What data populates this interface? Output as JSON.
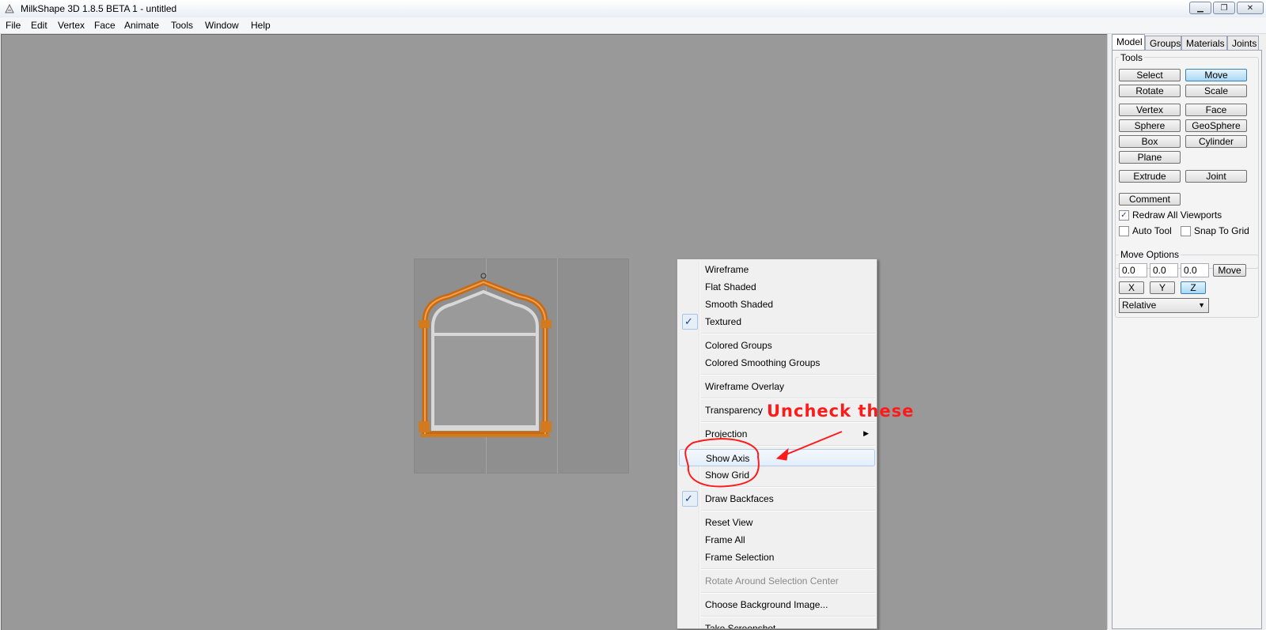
{
  "window": {
    "title": "MilkShape 3D 1.8.5 BETA 1 - untitled",
    "minimize": "▁",
    "maximize": "❐",
    "close": "✕"
  },
  "menubar": [
    "File",
    "Edit",
    "Vertex",
    "Face",
    "Animate",
    "Tools",
    "Window",
    "Help"
  ],
  "panel": {
    "tabs": [
      "Model",
      "Groups",
      "Materials",
      "Joints"
    ],
    "active_tab": "Model",
    "tools_label": "Tools",
    "tools": {
      "select": "Select",
      "move": "Move",
      "rotate": "Rotate",
      "scale": "Scale",
      "vertex": "Vertex",
      "face": "Face",
      "sphere": "Sphere",
      "geosphere": "GeoSphere",
      "box": "Box",
      "cylinder": "Cylinder",
      "plane": "Plane",
      "extrude": "Extrude",
      "joint": "Joint",
      "comment": "Comment"
    },
    "active_tool": "Move",
    "redraw_all": {
      "label": "Redraw All Viewports",
      "checked": true
    },
    "auto_tool": {
      "label": "Auto Tool",
      "checked": false
    },
    "snap_to_grid": {
      "label": "Snap To Grid",
      "checked": false
    },
    "move_options": {
      "label": "Move Options",
      "x_value": "0.0",
      "y_value": "0.0",
      "z_value": "0.0",
      "move_button": "Move",
      "axis_x": "X",
      "axis_y": "Y",
      "axis_z": "Z",
      "active_axis": "Z",
      "mode": "Relative"
    },
    "check_mark": "✓"
  },
  "context_menu": {
    "check_mark": "✓",
    "submenu_arrow": "▶",
    "items": [
      {
        "label": "Wireframe",
        "checked": false
      },
      {
        "label": "Flat Shaded",
        "checked": false
      },
      {
        "label": "Smooth Shaded",
        "checked": false
      },
      {
        "label": "Textured",
        "checked": true
      },
      {
        "label": "Colored Groups",
        "checked": false
      },
      {
        "label": "Colored Smoothing Groups",
        "checked": false
      },
      {
        "label": "Wireframe Overlay",
        "checked": false
      },
      {
        "label": "Transparency",
        "checked": false
      },
      {
        "label": "Projection",
        "submenu": true
      },
      {
        "label": "Show Axis",
        "checked": false,
        "highlighted": true
      },
      {
        "label": "Show Grid",
        "checked": false
      },
      {
        "label": "Draw Backfaces",
        "checked": true
      },
      {
        "label": "Reset View"
      },
      {
        "label": "Frame All"
      },
      {
        "label": "Frame Selection"
      },
      {
        "label": "Rotate Around Selection Center",
        "disabled": true
      },
      {
        "label": "Choose Background Image..."
      },
      {
        "label": "Take Screenshot"
      }
    ]
  },
  "annotation": {
    "text": "Uncheck these",
    "color": "#ff1a1a"
  },
  "colors": {
    "viewport_bg": "#999999",
    "frame_orange": "#d27a1e",
    "button_active": "#a8d8f4"
  }
}
